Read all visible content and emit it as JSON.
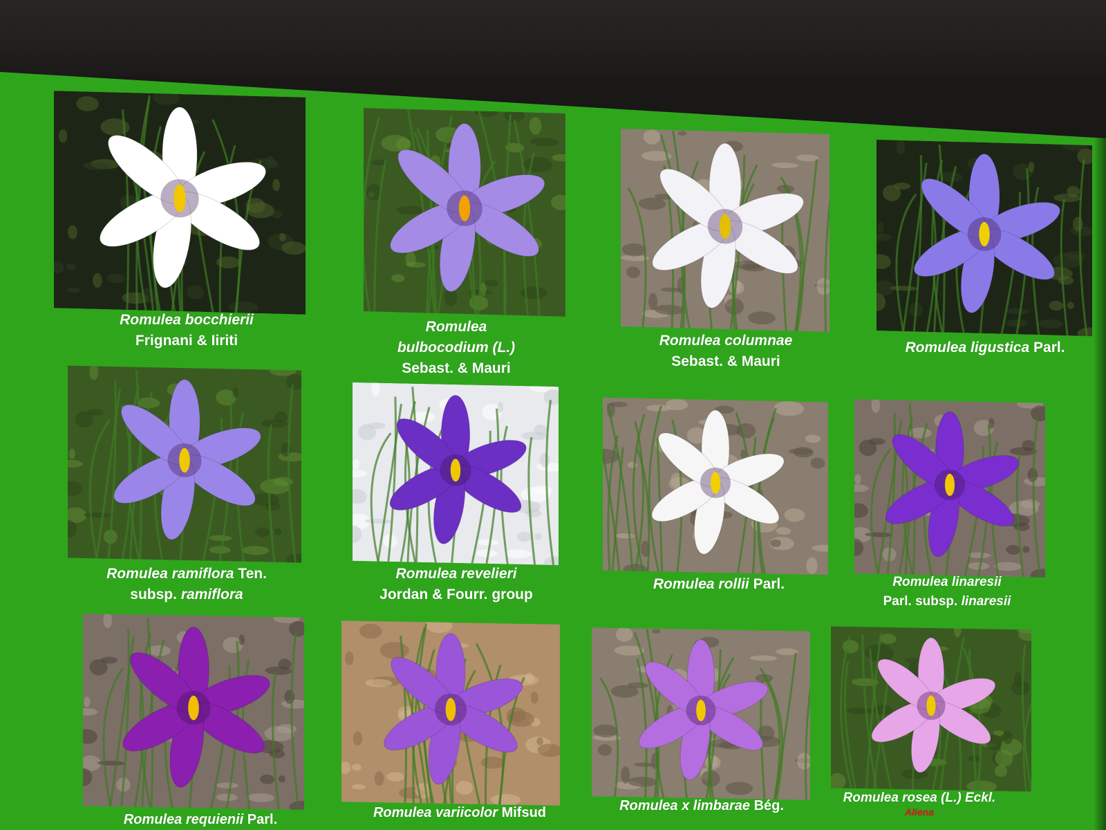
{
  "slide": {
    "background_color": "#2fa51c",
    "cards": [
      {
        "id": "bocchierii",
        "line1": "Romulea bocchierii",
        "line2": "Frignani & Iiriti",
        "flower_color": "#ffffff",
        "center": "#f2c700",
        "bg": "dark-grass"
      },
      {
        "id": "bulbocodium",
        "line1": "Romulea",
        "line2": "bulbocodium (L.)",
        "line3": "Sebast. & Mauri",
        "flower_color": "#a48be6",
        "center": "#f2a100",
        "bg": "grass"
      },
      {
        "id": "columnae",
        "line1": "Romulea columnae",
        "line2": "Sebast. & Mauri",
        "flower_color": "#f2f2f7",
        "center": "#e2c000",
        "bg": "gravel"
      },
      {
        "id": "ligustica",
        "line1_it": "Romulea ligustica",
        "line1_rest": " Parl.",
        "flower_color": "#8a7ae8",
        "center": "#f0d000",
        "bg": "dark-grass"
      },
      {
        "id": "ramiflora",
        "line1_it": "Romulea ramiflora",
        "line1_rest": " Ten.",
        "line2_pre": "subsp. ",
        "line2_it": "ramiflora",
        "flower_color": "#9a86e8",
        "center": "#f0c800",
        "bg": "grass"
      },
      {
        "id": "revelieri",
        "line1": "Romulea revelieri",
        "line2": "Jordan & Fourr. group",
        "flower_color": "#6b2fc4",
        "center": "#f0c800",
        "bg": "white"
      },
      {
        "id": "rollii",
        "line1_it": "Romulea rollii",
        "line1_rest": " Parl.",
        "flower_color": "#f6f6f6",
        "center": "#f2d000",
        "bg": "gravel"
      },
      {
        "id": "linaresii",
        "line1": "Romulea linaresii",
        "line2_pre": "Parl. subsp. ",
        "line2_it": "linaresii",
        "flower_color": "#7a2ed0",
        "center": "#f2c800",
        "bg": "rock"
      },
      {
        "id": "requienii",
        "line1_it": "Romulea requienii",
        "line1_rest": " Parl.",
        "flower_color": "#8a1fb0",
        "center": "#f0c000",
        "bg": "rock"
      },
      {
        "id": "variicolor",
        "line1_it": "Romulea variicolor",
        "line1_rest": " Mifsud",
        "flower_color": "#9a55d8",
        "center": "#f0c000",
        "bg": "sand"
      },
      {
        "id": "limbarae",
        "line1_it": "Romulea x limbarae",
        "line1_rest": " Bég.",
        "flower_color": "#b46ee0",
        "center": "#f2c800",
        "bg": "gravel"
      },
      {
        "id": "rosea",
        "line1_it": "Romulea rosea",
        "line1_rest": "  (L.) Eckl.",
        "line2_red": "Aliena",
        "flower_color": "#e7a6e8",
        "center": "#f0c800",
        "bg": "grass"
      }
    ]
  }
}
